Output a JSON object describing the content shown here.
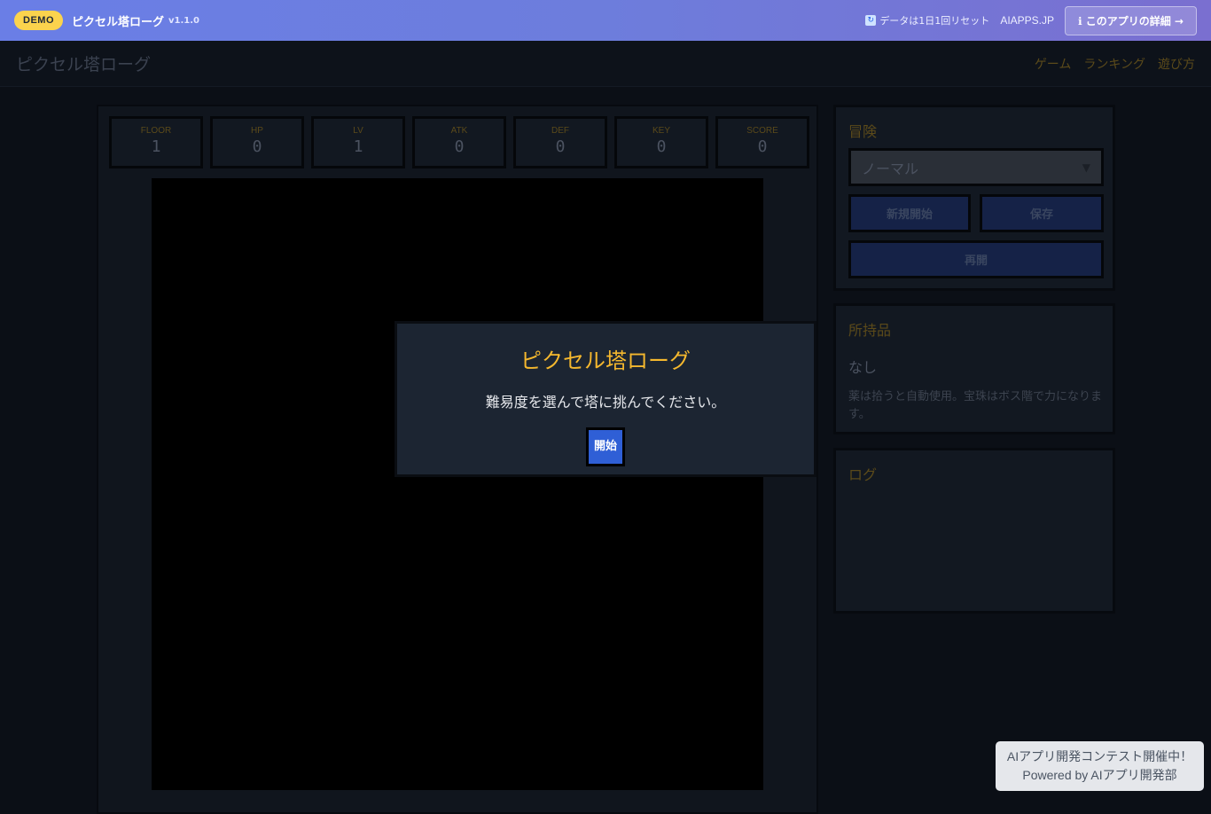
{
  "demo_bar": {
    "badge": "DEMO",
    "title": "ピクセル塔ローグ",
    "version": "v1.1.0",
    "reset_note": "データは1日1回リセット",
    "site": "AIAPPS.JP",
    "detail_button": "ℹ このアプリの詳細 →"
  },
  "header": {
    "logo": "ピクセル塔ローグ",
    "nav": [
      "ゲーム",
      "ランキング",
      "遊び方"
    ]
  },
  "stats": [
    {
      "label": "FLOOR",
      "value": "1"
    },
    {
      "label": "HP",
      "value": "0"
    },
    {
      "label": "LV",
      "value": "1"
    },
    {
      "label": "ATK",
      "value": "0"
    },
    {
      "label": "DEF",
      "value": "0"
    },
    {
      "label": "KEY",
      "value": "0"
    },
    {
      "label": "SCORE",
      "value": "0"
    }
  ],
  "adventure": {
    "title": "冒険",
    "difficulty": "ノーマル",
    "new_game": "新規開始",
    "save": "保存",
    "resume": "再開"
  },
  "inventory": {
    "title": "所持品",
    "value": "なし",
    "note": "薬は拾うと自動使用。宝珠はボス階で力になります。"
  },
  "log": {
    "title": "ログ"
  },
  "modal": {
    "title": "ピクセル塔ローグ",
    "text": "難易度を選んで塔に挑んでください。",
    "start": "開始"
  },
  "contest": {
    "line1": "AIアプリ開発コンテスト開催中！",
    "line2": "Powered by AIアプリ開発部"
  }
}
